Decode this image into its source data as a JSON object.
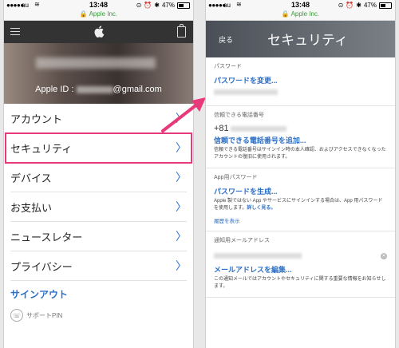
{
  "status": {
    "carrier": "au",
    "time": "13:48",
    "battery": "47%"
  },
  "url": "Apple Inc.",
  "left": {
    "apple_id_label": "Apple ID :",
    "apple_id_domain": "@gmail.com",
    "menu": [
      {
        "label": "アカウント"
      },
      {
        "label": "セキュリティ"
      },
      {
        "label": "デバイス"
      },
      {
        "label": "お支払い"
      },
      {
        "label": "ニュースレター"
      },
      {
        "label": "プライバシー"
      }
    ],
    "sign_out": "サインアウト",
    "support_pin": "サポートPIN"
  },
  "right": {
    "back": "戻る",
    "title": "セキュリティ",
    "password_label": "パスワード",
    "password_link": "パスワードを変更...",
    "trusted_phone_label": "信頼できる電話番号",
    "trusted_phone_prefix": "+81",
    "trusted_phone_link": "信頼できる電話番号を追加...",
    "trusted_phone_note": "信頼できる電話番号はサインイン時の本人確認、およびアクセスできなくなったアカウントの復旧に使用されます。",
    "app_pw_label": "App用パスワード",
    "app_pw_link": "パスワードを生成...",
    "app_pw_note": "Apple 製ではない App やサービスにサインインする場合は、App 用パスワードを使用します。",
    "app_pw_more": "詳しく見る。",
    "history_link": "履歴を表示",
    "notify_email_label": "通知用メールアドレス",
    "notify_email_link": "メールアドレスを編集...",
    "notify_email_note": "この通知メールではアカウントやセキュリティに関する重要な情報をお知らせします。"
  },
  "colors": {
    "link": "#2b6fc6",
    "highlight": "#e8397a",
    "url_green": "#3a9a3a"
  }
}
